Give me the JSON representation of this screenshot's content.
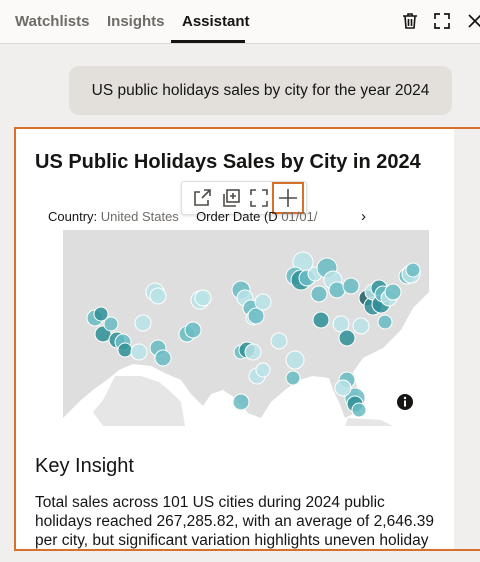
{
  "tabs": [
    {
      "label": "Watchlists",
      "active": false
    },
    {
      "label": "Insights",
      "active": false
    },
    {
      "label": "Assistant",
      "active": true
    }
  ],
  "toolbar_icons": [
    "trash-icon",
    "expand-icon",
    "close-icon"
  ],
  "user_message": "US public holidays sales by city for the year 2024",
  "card": {
    "title": "US Public Holidays Sales by City in 2024",
    "viz_toolbar_icons": [
      "export-icon",
      "duplicate-icon",
      "fullscreen-icon",
      "add-icon"
    ],
    "filters": [
      {
        "label": "Country:",
        "value": "United States"
      },
      {
        "label": "Order Date (D",
        "value": "01/01/"
      }
    ],
    "key_insight_heading": "Key Insight",
    "key_insight_text": "Total sales across 101 US cities during 2024 public holidays reached 267,285.82, with an average of 2,646.39 per city, but significant variation highlights uneven holiday performance—top performers like"
  },
  "colors": {
    "accent": "#d7702c",
    "land": "#dddddd",
    "bubble_light": "#b9e3e6",
    "bubble_mid": "#69bcc3",
    "bubble_dark": "#2e8f95",
    "bubble_darkest": "#1d5d64"
  }
}
